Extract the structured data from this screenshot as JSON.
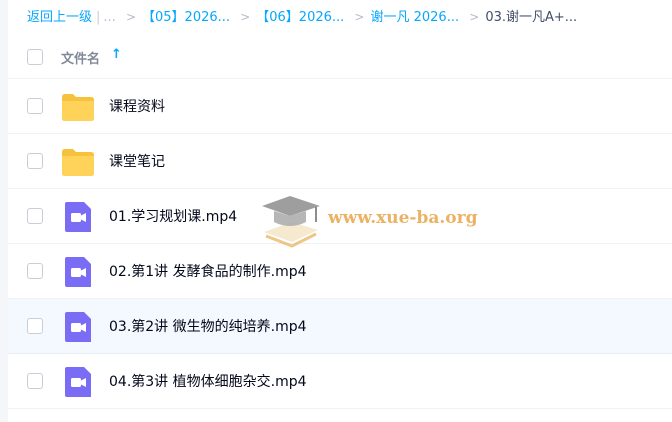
{
  "breadcrumb": {
    "back": "返回上一级",
    "ellipsis": "...",
    "crumbs": [
      "【05】2026...",
      "【06】2026...",
      "谢一凡 2026..."
    ],
    "current": "03.谢一凡A+..."
  },
  "header": {
    "column_title": "文件名",
    "sort_arrow": "↑"
  },
  "files": [
    {
      "name": "课程资料",
      "icon": "folder-icon"
    },
    {
      "name": "课堂笔记",
      "icon": "folder-icon"
    },
    {
      "name": "01.学习规划课.mp4",
      "icon": "video-icon"
    },
    {
      "name": "02.第1讲 发酵食品的制作.mp4",
      "icon": "video-icon"
    },
    {
      "name": "03.第2讲 微生物的纯培养.mp4",
      "icon": "video-icon"
    },
    {
      "name": "04.第3讲 植物体细胞杂交.mp4",
      "icon": "video-icon"
    }
  ],
  "watermark": {
    "text": "www.xue-ba.org"
  },
  "colors": {
    "accent": "#06a7ff",
    "folder": "#ffd35a",
    "video": "#7b6cf5",
    "hover_row": "#f4f8ff"
  }
}
